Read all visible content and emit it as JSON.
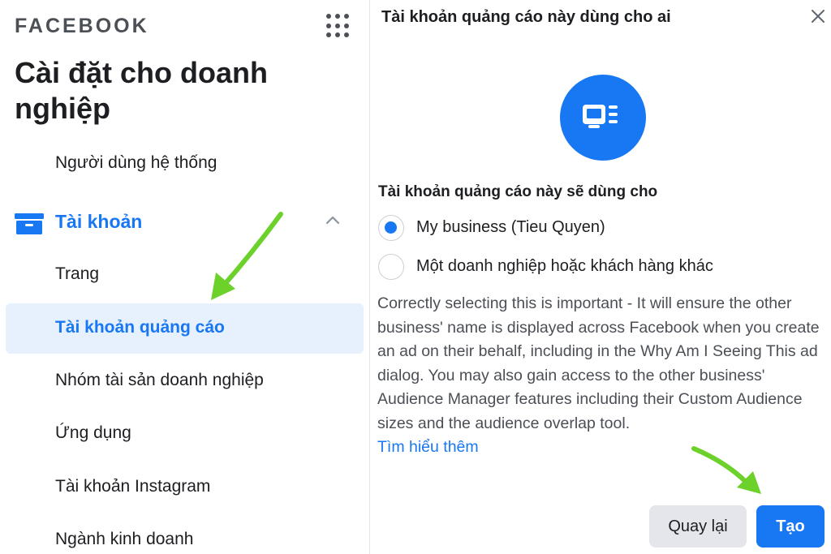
{
  "sidebar": {
    "brand": "FACEBOOK",
    "title": "Cài đặt cho doanh nghiệp",
    "items_top": [
      "Người dùng hệ thống"
    ],
    "section_label": "Tài khoản",
    "items": [
      {
        "label": "Trang"
      },
      {
        "label": "Tài khoản quảng cáo",
        "active": true
      },
      {
        "label": "Nhóm tài sản doanh nghiệp"
      },
      {
        "label": "Ứng dụng"
      },
      {
        "label": "Tài khoản Instagram"
      },
      {
        "label": "Ngành kinh doanh"
      }
    ]
  },
  "dialog": {
    "title": "Tài khoản quảng cáo này dùng cho ai",
    "question": "Tài khoản quảng cáo này sẽ dùng cho",
    "options": [
      {
        "label": "My business (Tieu Quyen)",
        "selected": true
      },
      {
        "label": "Một doanh nghiệp hoặc khách hàng khác",
        "selected": false
      }
    ],
    "description": "Correctly selecting this is important - It will ensure the other business' name is displayed across Facebook when you create an ad on their behalf, including in the Why Am I Seeing This ad dialog. You may also gain access to the other business' Audience Manager features including their Custom Audience sizes and the audience overlap tool.",
    "learn_more": "Tìm hiểu thêm",
    "back_label": "Quay lại",
    "create_label": "Tạo"
  },
  "colors": {
    "accent": "#1877f2",
    "active_bg": "#e7f0fd",
    "annotation_arrow": "#6cd12a"
  }
}
